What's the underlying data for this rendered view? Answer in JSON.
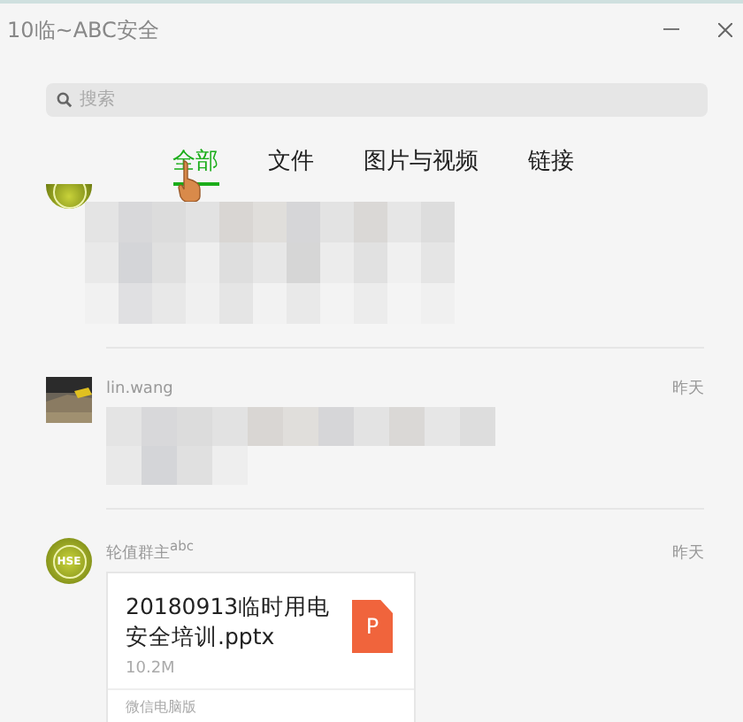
{
  "window": {
    "title": "10临~ABC安全"
  },
  "search": {
    "placeholder": "搜索"
  },
  "tabs": [
    {
      "label": "全部",
      "selected": true
    },
    {
      "label": "文件",
      "selected": false
    },
    {
      "label": "图片与视频",
      "selected": false
    },
    {
      "label": "链接",
      "selected": false
    }
  ],
  "messages": [
    {
      "kind": "redacted",
      "avatar": {
        "kind": "badge"
      }
    },
    {
      "kind": "redacted",
      "sender": "lin.wang",
      "time": "昨天"
    },
    {
      "kind": "file",
      "avatar": {
        "kind": "badge",
        "text": "HSE"
      },
      "sender": "轮值群主$^{abc}$",
      "time": "昨天",
      "file": {
        "name": "20180913临时用电安全培训.pptx",
        "size": "10.2M",
        "source": "微信电脑版",
        "type": "P"
      }
    }
  ]
}
